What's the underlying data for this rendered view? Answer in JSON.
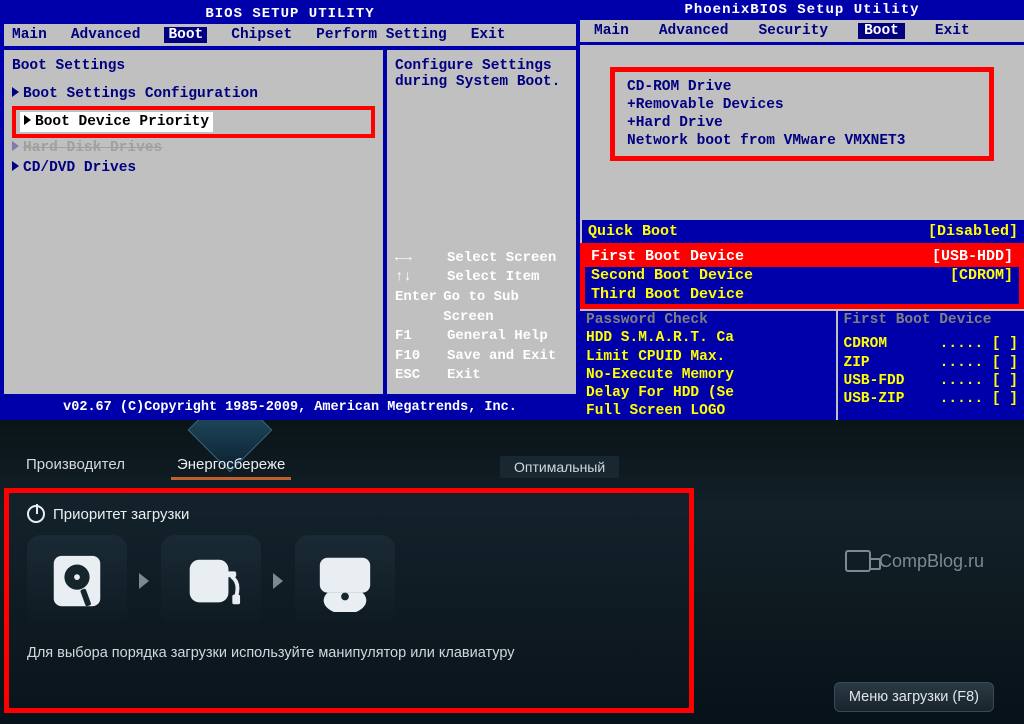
{
  "ami": {
    "title": "BIOS SETUP UTILITY",
    "menu": [
      "Main",
      "Advanced",
      "Boot",
      "Chipset",
      "Perform Setting",
      "Exit"
    ],
    "active_menu": "Boot",
    "heading": "Boot Settings",
    "items": {
      "cfg": "Boot Settings Configuration",
      "priority": "Boot Device Priority",
      "hdd": "Hard Disk Drives",
      "cddvd": "CD/DVD Drives"
    },
    "help_top_line1": "Configure Settings",
    "help_top_line2": "during System Boot.",
    "keys": [
      {
        "k": "←→",
        "d": "Select Screen"
      },
      {
        "k": "↑↓",
        "d": "Select Item"
      },
      {
        "k": "Enter",
        "d": "Go to Sub Screen"
      },
      {
        "k": "F1",
        "d": "General Help"
      },
      {
        "k": "F10",
        "d": "Save and Exit"
      },
      {
        "k": "ESC",
        "d": "Exit"
      }
    ],
    "footer": "v02.67 (C)Copyright 1985-2009, American Megatrends, Inc."
  },
  "phoenix": {
    "title": "PhoenixBIOS Setup Utility",
    "menu": [
      "Main",
      "Advanced",
      "Security",
      "Boot",
      "Exit"
    ],
    "active_menu": "Boot",
    "items": [
      "CD-ROM Drive",
      "+Removable Devices",
      "+Hard Drive",
      "Network boot from VMware VMXNET3"
    ]
  },
  "bluepanel": {
    "head_left": "Quick Boot",
    "head_right": "[Disabled]",
    "boot_rows": [
      {
        "label": "First Boot Device",
        "val": "[USB-HDD]",
        "sel": true
      },
      {
        "label": "Second Boot Device",
        "val": "[CDROM]",
        "sel": false
      },
      {
        "label": "Third Boot Device",
        "val": "",
        "sel": false
      }
    ],
    "left_lines": [
      {
        "t": "Password Check",
        "dim": true
      },
      {
        "t": "HDD S.M.A.R.T. Ca",
        "dim": false
      },
      {
        "t": "Limit CPUID Max.",
        "dim": false
      },
      {
        "t": "No-Execute Memory",
        "dim": false
      },
      {
        "t": "Delay For HDD (Se",
        "dim": false
      },
      {
        "t": "Full Screen LOGO",
        "dim": false
      }
    ],
    "right_header": "First Boot Device",
    "right_lines": [
      {
        "name": "CDROM",
        "mark": "[ ]"
      },
      {
        "name": "ZIP",
        "mark": "[ ]"
      },
      {
        "name": "USB-FDD",
        "mark": "[ ]"
      },
      {
        "name": "USB-ZIP",
        "mark": "[ ]"
      }
    ]
  },
  "uefi": {
    "tabs": [
      "Производител",
      "Энергосбереже"
    ],
    "tab_right": "Оптимальный",
    "heading": "Приоритет загрузки",
    "tiles": [
      "hdd-icon",
      "usb-icon",
      "cd-icon"
    ],
    "hint": "Для выбора порядка загрузки используйте манипулятор или клавиатуру",
    "logo": "CompBlog.ru",
    "bottom_button": "Меню загрузки (F8)"
  }
}
